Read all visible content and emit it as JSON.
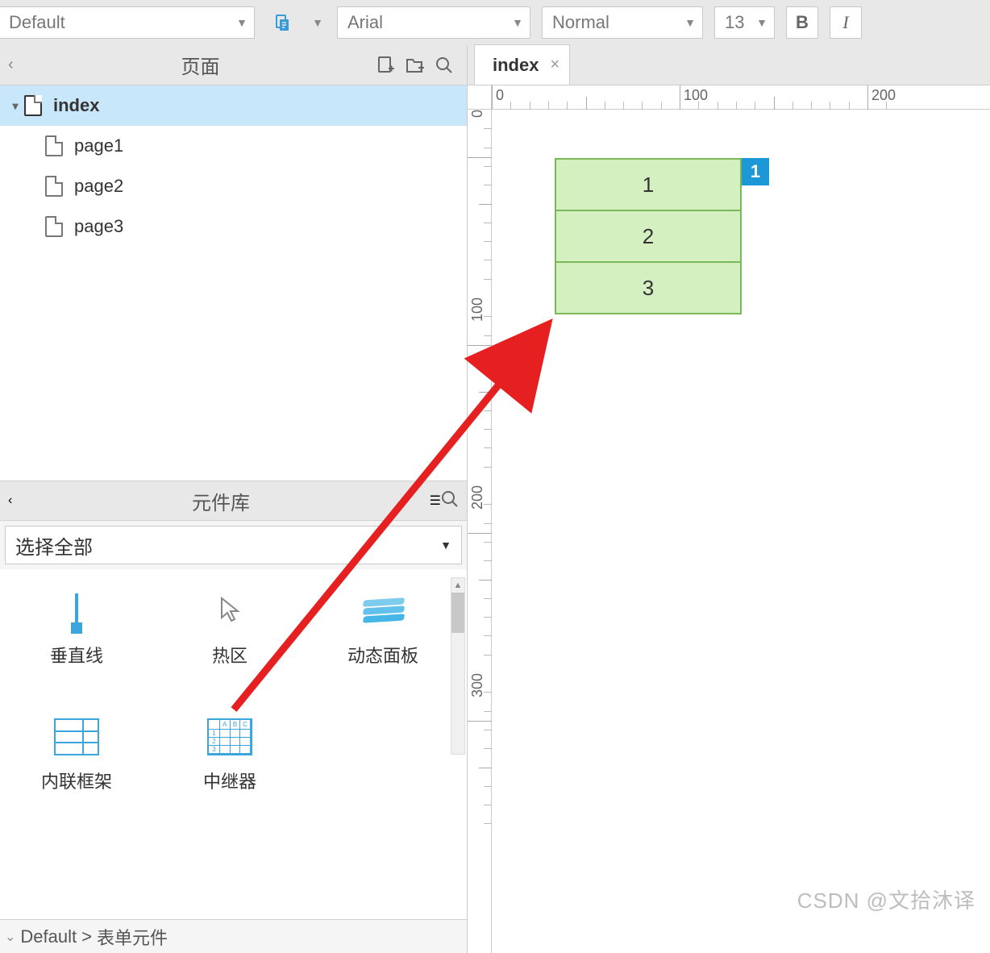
{
  "toolbar": {
    "style_dropdown": "Default",
    "font_dropdown": "Arial",
    "weight_dropdown": "Normal",
    "size_dropdown": "13",
    "bold_label": "B",
    "italic_label": "I"
  },
  "pages_panel": {
    "title": "页面",
    "items": [
      {
        "label": "index",
        "selected": true,
        "depth": 0
      },
      {
        "label": "page1",
        "selected": false,
        "depth": 1
      },
      {
        "label": "page2",
        "selected": false,
        "depth": 1
      },
      {
        "label": "page3",
        "selected": false,
        "depth": 1
      }
    ]
  },
  "library_panel": {
    "title": "元件库",
    "select_label": "选择全部",
    "items_row1": [
      {
        "label": "垂直线",
        "icon": "vline"
      },
      {
        "label": "热区",
        "icon": "cursor"
      },
      {
        "label": "动态面板",
        "icon": "dynpanel"
      }
    ],
    "items_row2": [
      {
        "label": "内联框架",
        "icon": "iframe"
      },
      {
        "label": "中继器",
        "icon": "repeater"
      }
    ]
  },
  "breadcrumb": {
    "root": "Default",
    "current": "表单元件"
  },
  "canvas": {
    "tab_label": "index",
    "ruler_h": [
      "0",
      "100",
      "200"
    ],
    "ruler_v": [
      "0",
      "100",
      "200",
      "300"
    ],
    "repeater_rows": [
      "1",
      "2",
      "3"
    ],
    "selection_badge": "1"
  },
  "watermark": "CSDN @文拾沐译"
}
